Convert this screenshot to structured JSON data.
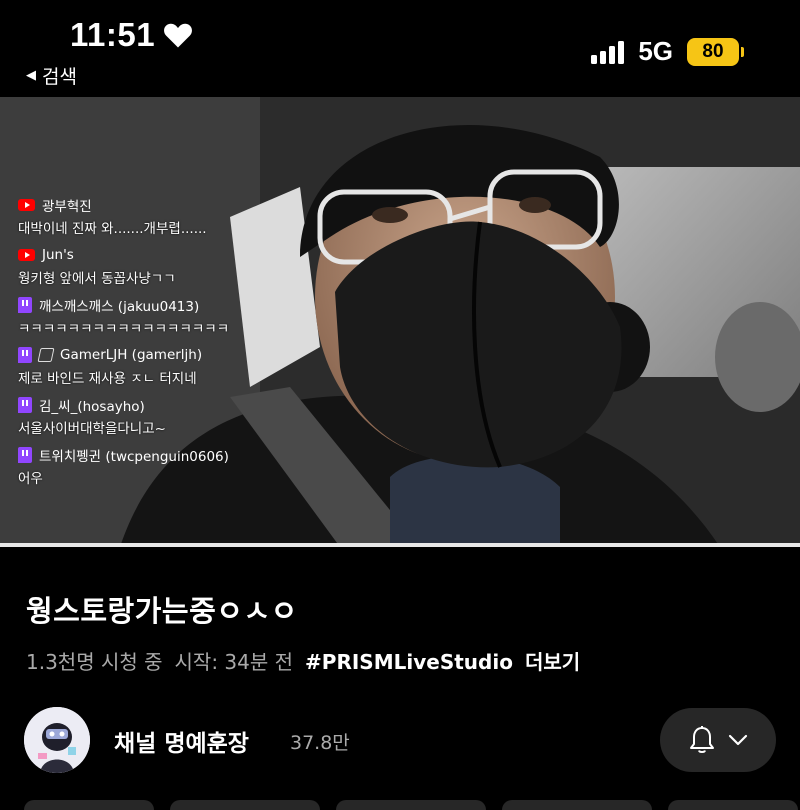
{
  "status_bar": {
    "time": "11:51",
    "network": "5G",
    "battery": "80",
    "back_label": "검색",
    "icons": [
      "heart-icon",
      "signal-icon",
      "battery-icon",
      "back-arrow-icon"
    ]
  },
  "video": {
    "progress_fraction": 1.0,
    "chat": [
      {
        "platform": "youtube",
        "user": "광부혁진",
        "message": "대박이네 진짜 와.......개부렵......"
      },
      {
        "platform": "youtube",
        "user": "Jun's",
        "message": "웡키형 앞에서 동꼽사냥ㄱㄱ"
      },
      {
        "platform": "twitch",
        "user": "깨스깨스깨스 (jakuu0413)",
        "message": "ㅋㅋㅋㅋㅋㅋㅋㅋㅋㅋㅋㅋㅋㅋㅋㅋㅋ"
      },
      {
        "platform": "twitch",
        "user": "GamerLJH (gamerljh)",
        "message": "제로 바인드 재사용 ㅈㄴ 터지네"
      },
      {
        "platform": "twitch",
        "user": "김_씨_(hosayho)",
        "message": "서울사이버대학을다니고~"
      },
      {
        "platform": "twitch",
        "user": "트위치펭귄 (twcpenguin0606)",
        "message": "어우"
      }
    ]
  },
  "info": {
    "title": "웡스토랑가는중ㅇㅅㅇ",
    "viewers": "1.3천명 시청 중",
    "started": "시작: 34분 전",
    "hashtag": "#PRISMLiveStudio",
    "more": "더보기"
  },
  "channel": {
    "name": "채널 명예훈장",
    "subscribers": "37.8만"
  },
  "colors": {
    "background": "#000000",
    "battery": "#f6c515",
    "youtube": "#ff0000",
    "twitch": "#9146ff",
    "secondary_text": "#aaaaaa",
    "button_bg": "#272727"
  }
}
